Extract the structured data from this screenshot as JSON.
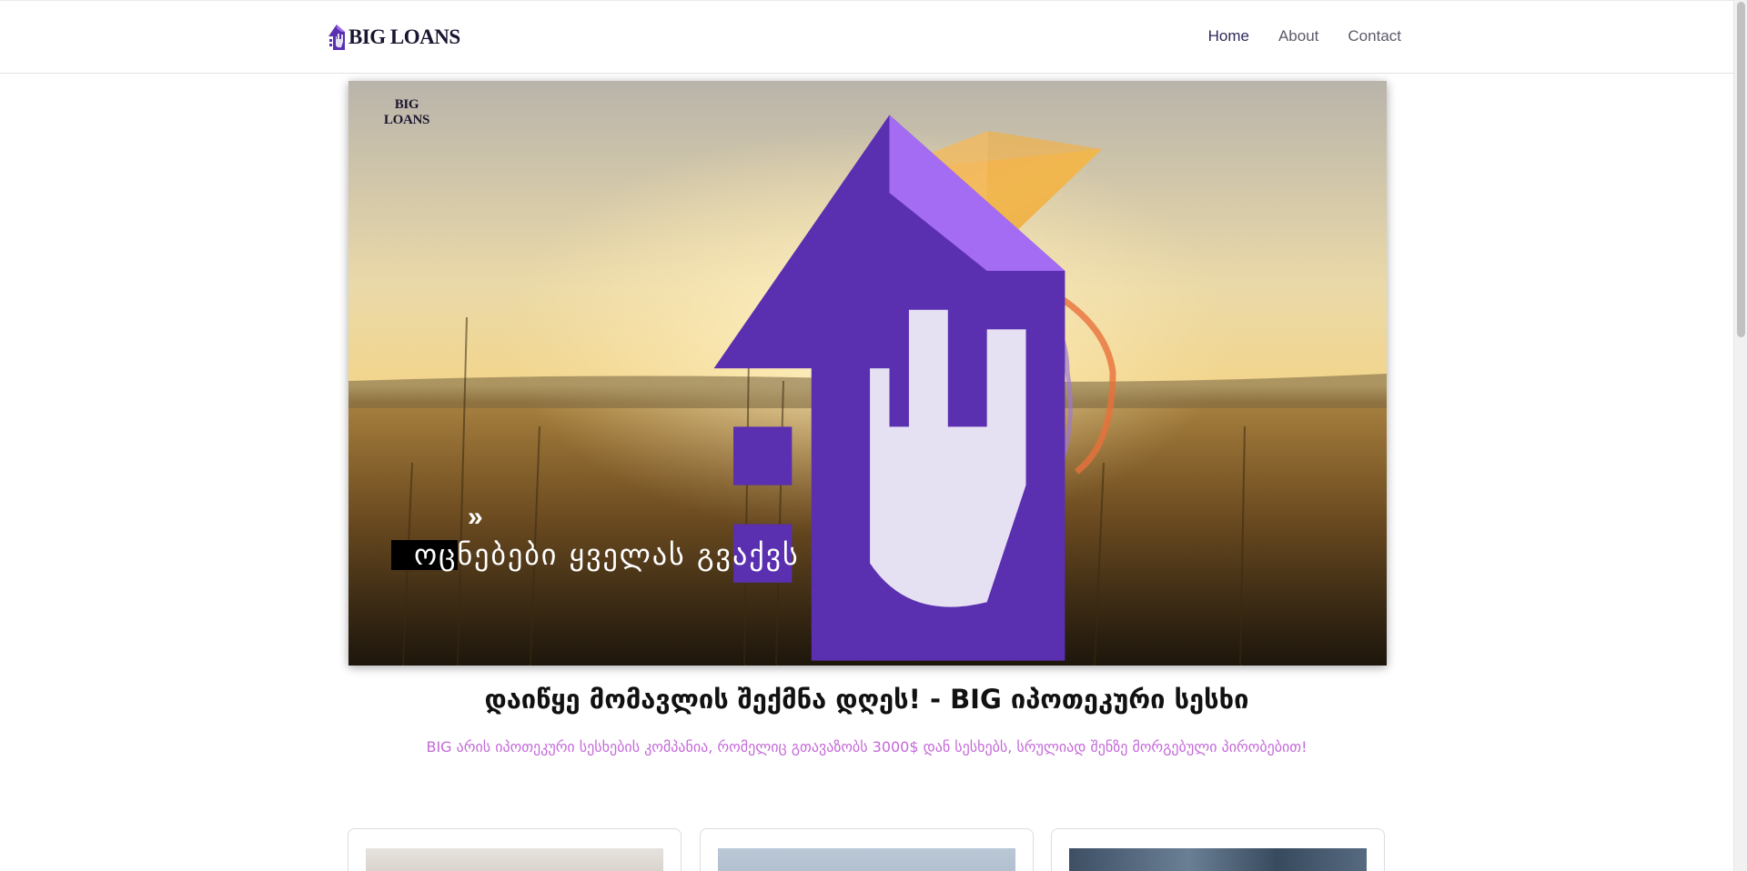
{
  "header": {
    "brand_name": "BIG LOANS",
    "nav": [
      {
        "label": "Home",
        "active": true
      },
      {
        "label": "About",
        "active": false
      },
      {
        "label": "Contact",
        "active": false
      }
    ]
  },
  "hero": {
    "logo_text": "BIG LOANS",
    "chevrons": "»",
    "slogan": "ოცნებები ყველას გვაქვს"
  },
  "main": {
    "headline": "დაიწყე მომავლის შექმნა დღეს! - BIG იპოთეკური სესხი",
    "subline": "BIG არის იპოთეკური სესხების კომპანია, რომელიც გთავაზობს 3000$ დან სესხებს, სრულიად შენზე მორგებული პირობებით!"
  },
  "colors": {
    "brand_purple": "#7b3fd6",
    "subline_pink": "#c46ad8",
    "nav_active": "#2f2a5a"
  },
  "icons": {
    "brand_logo": "house-hand-logo-icon",
    "chevrons": "double-chevron-right-icon"
  }
}
